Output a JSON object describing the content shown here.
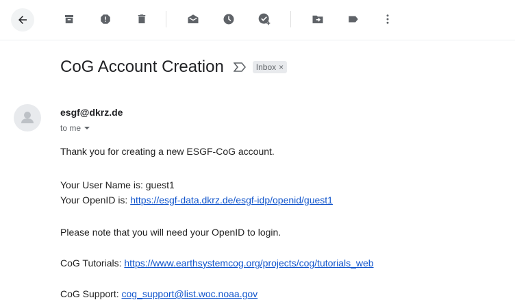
{
  "toolbar": {
    "back": "arrow-left-icon",
    "actions": [
      "archive-icon",
      "report-spam-icon",
      "delete-icon",
      "mark-unread-icon",
      "snooze-icon",
      "add-task-icon",
      "move-to-icon",
      "label-icon",
      "more-vert-icon"
    ]
  },
  "email": {
    "subject": "CoG Account Creation",
    "label": "Inbox",
    "label_remove": "×",
    "sender": "esgf@dkrz.de",
    "recipient": "to me",
    "lines": {
      "thanks": "Thank you for creating a new ESGF-CoG account.",
      "username_prefix": "Your User Name is: guest1",
      "openid_prefix": "Your OpenID is: ",
      "openid_link": "https://esgf-data.dkrz.de/esgf-idp/openid/guest1",
      "note": "Please note that you will need your OpenID to login.",
      "tutorials_prefix": "CoG Tutorials: ",
      "tutorials_link": "https://www.earthsystemcog.org/projects/cog/tutorials_web",
      "support_prefix": "CoG Support: ",
      "support_link": "cog_support@list.woc.noaa.gov"
    }
  },
  "colors": {
    "icon": "#5f6368",
    "link": "#1155cc",
    "label_bg": "#e8eaed"
  }
}
